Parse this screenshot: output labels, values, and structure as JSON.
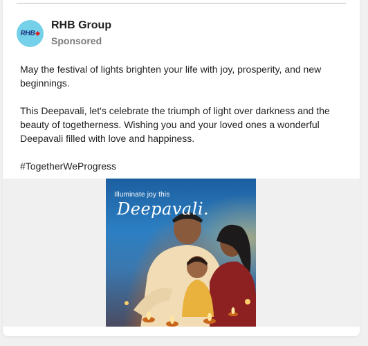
{
  "post": {
    "page_name": "RHB Group",
    "sponsored_label": "Sponsored",
    "avatar_logo_text": "RHB",
    "paragraphs": [
      "May the festival of lights brighten your life with joy, prosperity, and new beginnings.",
      "This Deepavali, let's celebrate the triumph of light over darkness and the beauty of togetherness. Wishing you and your loved ones a wonderful Deepavali filled with love and happiness.",
      "#TogetherWeProgress"
    ],
    "image": {
      "overlay_line1": "Illuminate joy this",
      "overlay_line2": "Deepavali."
    }
  },
  "colors": {
    "brand_accent": "#75d0ea",
    "brand_red": "#d8232a",
    "brand_navy": "#1b2f78",
    "page_background": "#f0f0f0",
    "card_background": "#ffffff"
  },
  "icons": {
    "avatar": "rhb-logo-icon"
  }
}
